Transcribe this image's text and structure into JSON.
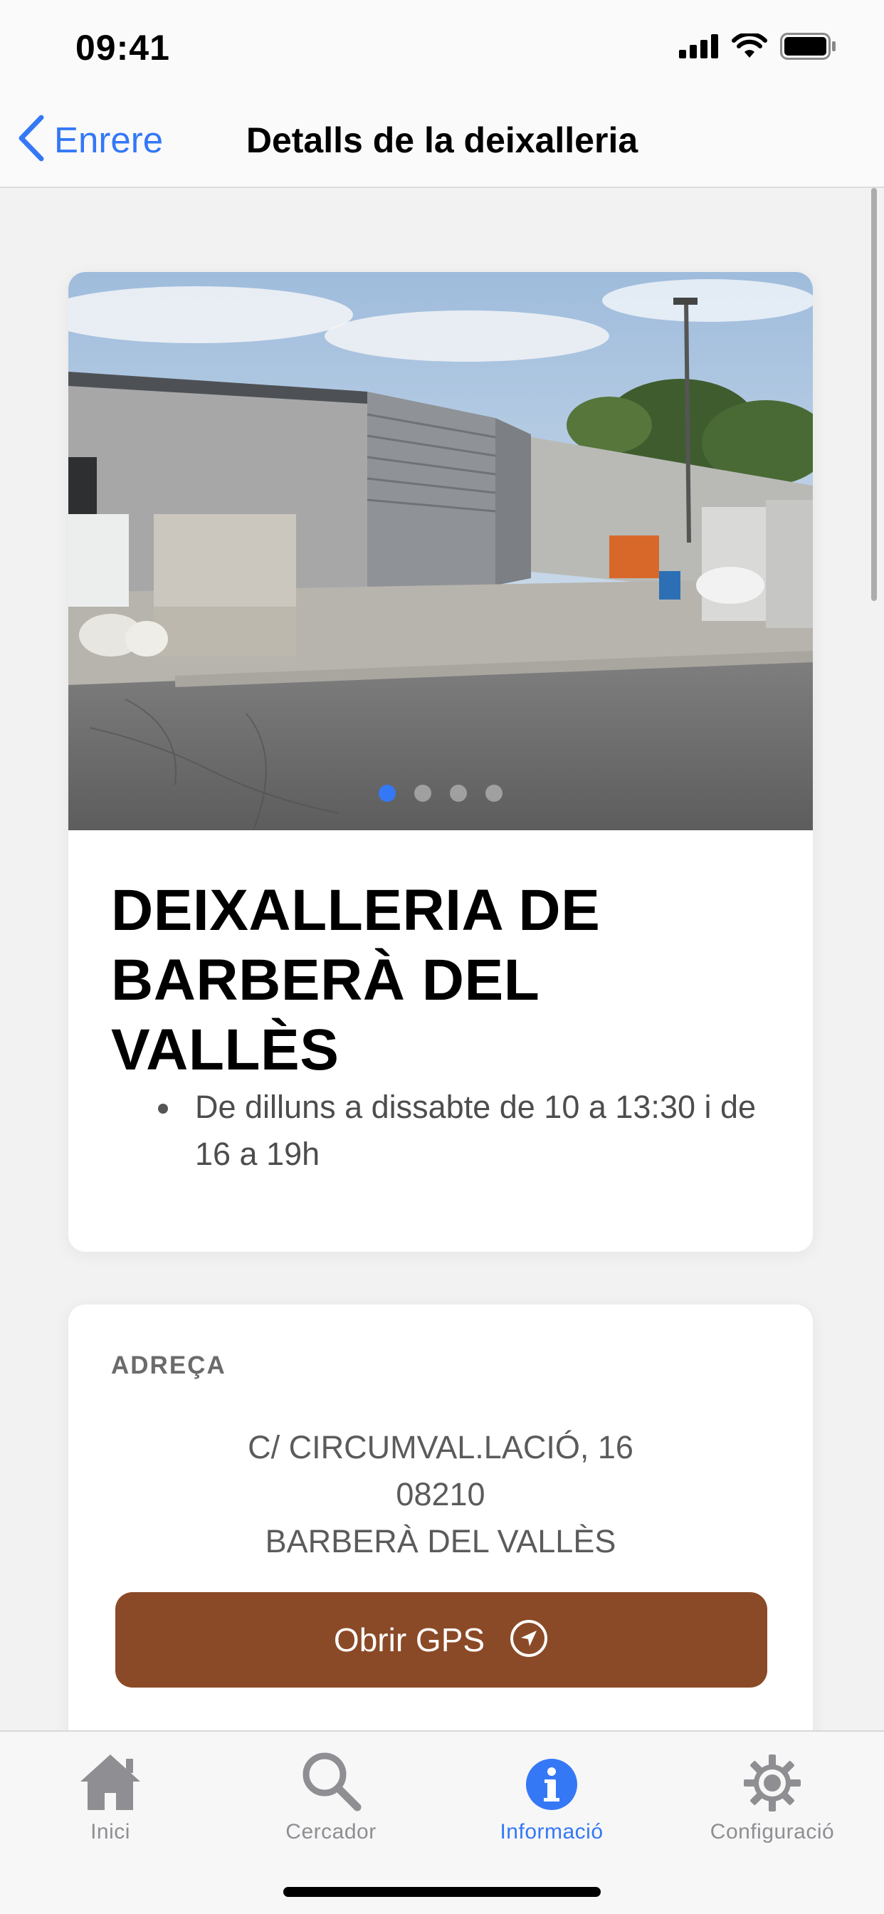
{
  "status_bar": {
    "time": "09:41"
  },
  "nav": {
    "back_label": "Enrere",
    "title": "Detalls de la deixalleria"
  },
  "gallery": {
    "page_count": 4,
    "current_page": 1
  },
  "facility": {
    "name": "DEIXALLERIA DE BARBERÀ DEL VALLÈS",
    "hours": [
      "De dilluns a dissabte de 10 a 13:30 i de 16 a 19h"
    ]
  },
  "address": {
    "section_label": "ADREÇA",
    "street": "C/ CIRCUMVAL.LACIÓ, 16",
    "postal_code": "08210",
    "city": "BARBERÀ DEL VALLÈS",
    "gps_button_label": "Obrir GPS"
  },
  "tab_bar": {
    "tabs": [
      {
        "label": "Inici",
        "icon": "house-icon"
      },
      {
        "label": "Cercador",
        "icon": "magnifier-icon"
      },
      {
        "label": "Informació",
        "icon": "info-icon"
      },
      {
        "label": "Configuració",
        "icon": "gear-icon"
      }
    ],
    "active_index": 2
  },
  "colors": {
    "accent": "#3478f6",
    "gps_button": "#8b4a27",
    "inactive_tab": "#8e8e93"
  }
}
